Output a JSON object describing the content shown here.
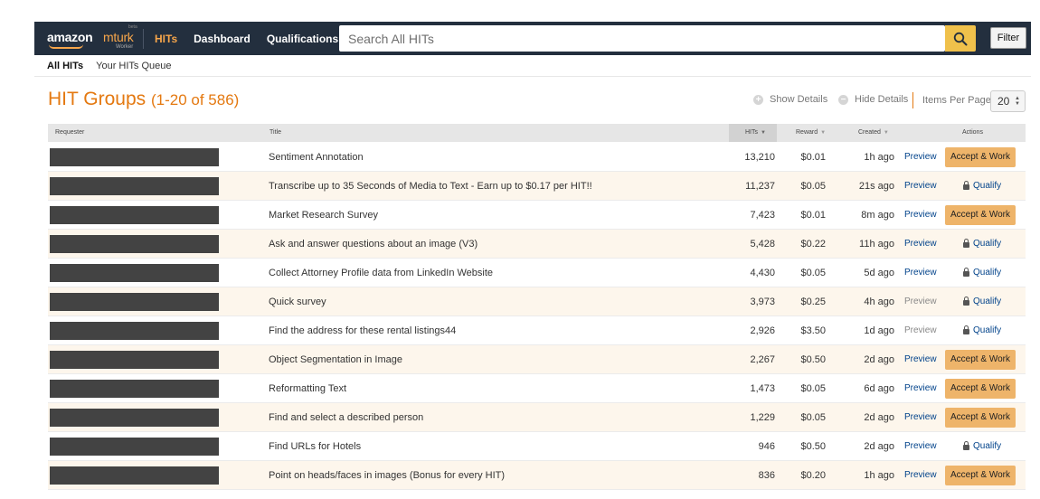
{
  "header": {
    "logo_amazon": "amazon",
    "logo_mturk": "mturk",
    "logo_worker": "Worker",
    "logo_beta": "beta",
    "nav": [
      {
        "label": "HITs",
        "active": true
      },
      {
        "label": "Dashboard",
        "active": false
      },
      {
        "label": "Qualifications",
        "active": false
      }
    ],
    "search_placeholder": "Search All HITs",
    "search_icon": "search-icon",
    "filter_label": "Filter"
  },
  "subnav": {
    "all_hits": "All HITs",
    "queue": "Your HITs Queue"
  },
  "groups": {
    "title": "HIT Groups",
    "count": "(1-20 of 586)",
    "show_details": "Show Details",
    "hide_details": "Hide Details",
    "items_per_page_label": "Items Per Page:",
    "items_per_page_value": "20"
  },
  "table": {
    "columns": {
      "requester": "Requester",
      "title": "Title",
      "hits": "HITs",
      "reward": "Reward",
      "created": "Created",
      "actions": "Actions"
    },
    "preview_label": "Preview",
    "accept_label": "Accept & Work",
    "qualify_label": "Qualify",
    "rows": [
      {
        "title": "Sentiment Annotation",
        "hits": "13,210",
        "reward": "$0.01",
        "created": "1h ago",
        "action": "accept",
        "preview_enabled": true
      },
      {
        "title": "Transcribe up to 35 Seconds of Media to Text - Earn up to $0.17 per HIT!!",
        "hits": "11,237",
        "reward": "$0.05",
        "created": "21s ago",
        "action": "qualify",
        "preview_enabled": true
      },
      {
        "title": "Market Research Survey",
        "hits": "7,423",
        "reward": "$0.01",
        "created": "8m ago",
        "action": "accept",
        "preview_enabled": true
      },
      {
        "title": "Ask and answer questions about an image (V3)",
        "hits": "5,428",
        "reward": "$0.22",
        "created": "11h ago",
        "action": "qualify",
        "preview_enabled": true
      },
      {
        "title": "Collect Attorney Profile data from LinkedIn Website",
        "hits": "4,430",
        "reward": "$0.05",
        "created": "5d ago",
        "action": "qualify",
        "preview_enabled": true
      },
      {
        "title": "Quick survey",
        "hits": "3,973",
        "reward": "$0.25",
        "created": "4h ago",
        "action": "qualify",
        "preview_enabled": false
      },
      {
        "title": "Find the address for these rental listings44",
        "hits": "2,926",
        "reward": "$3.50",
        "created": "1d ago",
        "action": "qualify",
        "preview_enabled": false
      },
      {
        "title": "Object Segmentation in Image",
        "hits": "2,267",
        "reward": "$0.50",
        "created": "2d ago",
        "action": "accept",
        "preview_enabled": true
      },
      {
        "title": "Reformatting Text",
        "hits": "1,473",
        "reward": "$0.05",
        "created": "6d ago",
        "action": "accept",
        "preview_enabled": true
      },
      {
        "title": "Find and select a described person",
        "hits": "1,229",
        "reward": "$0.05",
        "created": "2d ago",
        "action": "accept",
        "preview_enabled": true
      },
      {
        "title": "Find URLs for Hotels",
        "hits": "946",
        "reward": "$0.50",
        "created": "2d ago",
        "action": "qualify",
        "preview_enabled": true
      },
      {
        "title": "Point on heads/faces in images (Bonus for every HIT)",
        "hits": "836",
        "reward": "$0.20",
        "created": "1h ago",
        "action": "accept",
        "preview_enabled": true
      }
    ]
  },
  "colors": {
    "topbar": "#232f3e",
    "accent": "#e47911",
    "accept_button": "#eeb46a",
    "row_alt": "#fdf6ec",
    "link": "#00428a"
  }
}
